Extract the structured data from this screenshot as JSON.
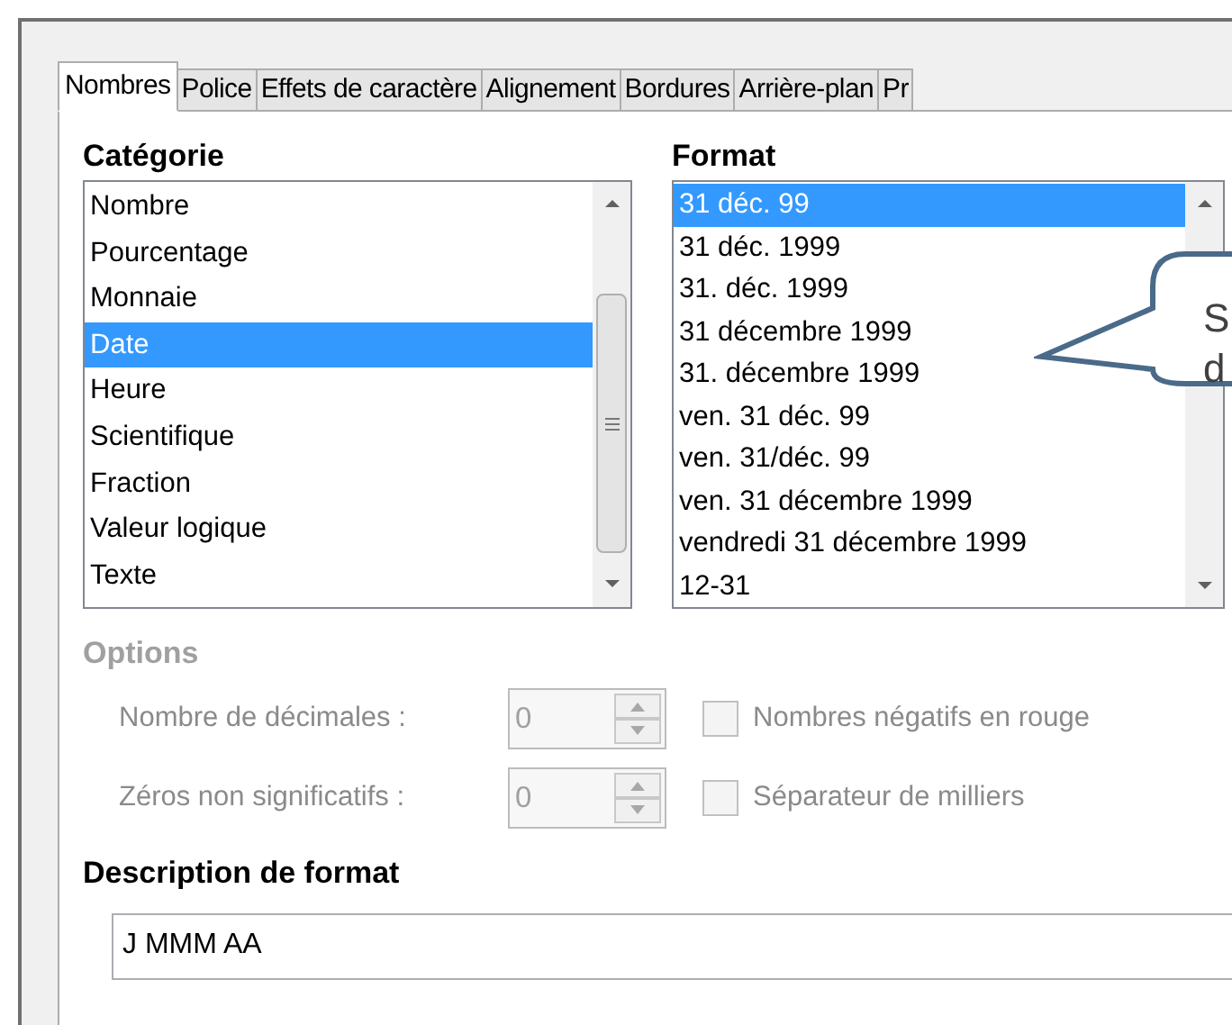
{
  "tabs": [
    {
      "label": "Nombres",
      "selected": true
    },
    {
      "label": "Police",
      "selected": false
    },
    {
      "label": "Effets de caractère",
      "selected": false
    },
    {
      "label": "Alignement",
      "selected": false
    },
    {
      "label": "Bordures",
      "selected": false
    },
    {
      "label": "Arrière-plan",
      "selected": false
    },
    {
      "label": "Pr",
      "selected": false
    }
  ],
  "category": {
    "label": "Catégorie",
    "items": [
      {
        "label": "Nombre",
        "selected": false
      },
      {
        "label": "Pourcentage",
        "selected": false
      },
      {
        "label": "Monnaie",
        "selected": false
      },
      {
        "label": "Date",
        "selected": true
      },
      {
        "label": "Heure",
        "selected": false
      },
      {
        "label": "Scientifique",
        "selected": false
      },
      {
        "label": "Fraction",
        "selected": false
      },
      {
        "label": "Valeur logique",
        "selected": false
      },
      {
        "label": "Texte",
        "selected": false
      }
    ]
  },
  "format": {
    "label": "Format",
    "items": [
      {
        "label": "31 déc. 99",
        "selected": true
      },
      {
        "label": "31 déc. 1999",
        "selected": false
      },
      {
        "label": "31. déc. 1999",
        "selected": false
      },
      {
        "label": "31 décembre 1999",
        "selected": false
      },
      {
        "label": "31. décembre 1999",
        "selected": false
      },
      {
        "label": "ven. 31 déc. 99",
        "selected": false
      },
      {
        "label": "ven. 31/déc. 99",
        "selected": false
      },
      {
        "label": "ven. 31 décembre 1999",
        "selected": false
      },
      {
        "label": "vendredi 31 décembre 1999",
        "selected": false
      },
      {
        "label": "12-31",
        "selected": false
      }
    ]
  },
  "options": {
    "label": "Options",
    "disabled": true,
    "rows": [
      {
        "spin_label": "Nombre de décimales :",
        "spin_value": "0",
        "check_label": "Nombres négatifs en rouge",
        "checked": false
      },
      {
        "spin_label": "Zéros non significatifs :",
        "spin_value": "0",
        "check_label": "Séparateur de milliers",
        "checked": false
      }
    ]
  },
  "description": {
    "label": "Description de format",
    "value": "J MMM AA"
  },
  "callout": {
    "lines": [
      "S",
      "d"
    ]
  }
}
